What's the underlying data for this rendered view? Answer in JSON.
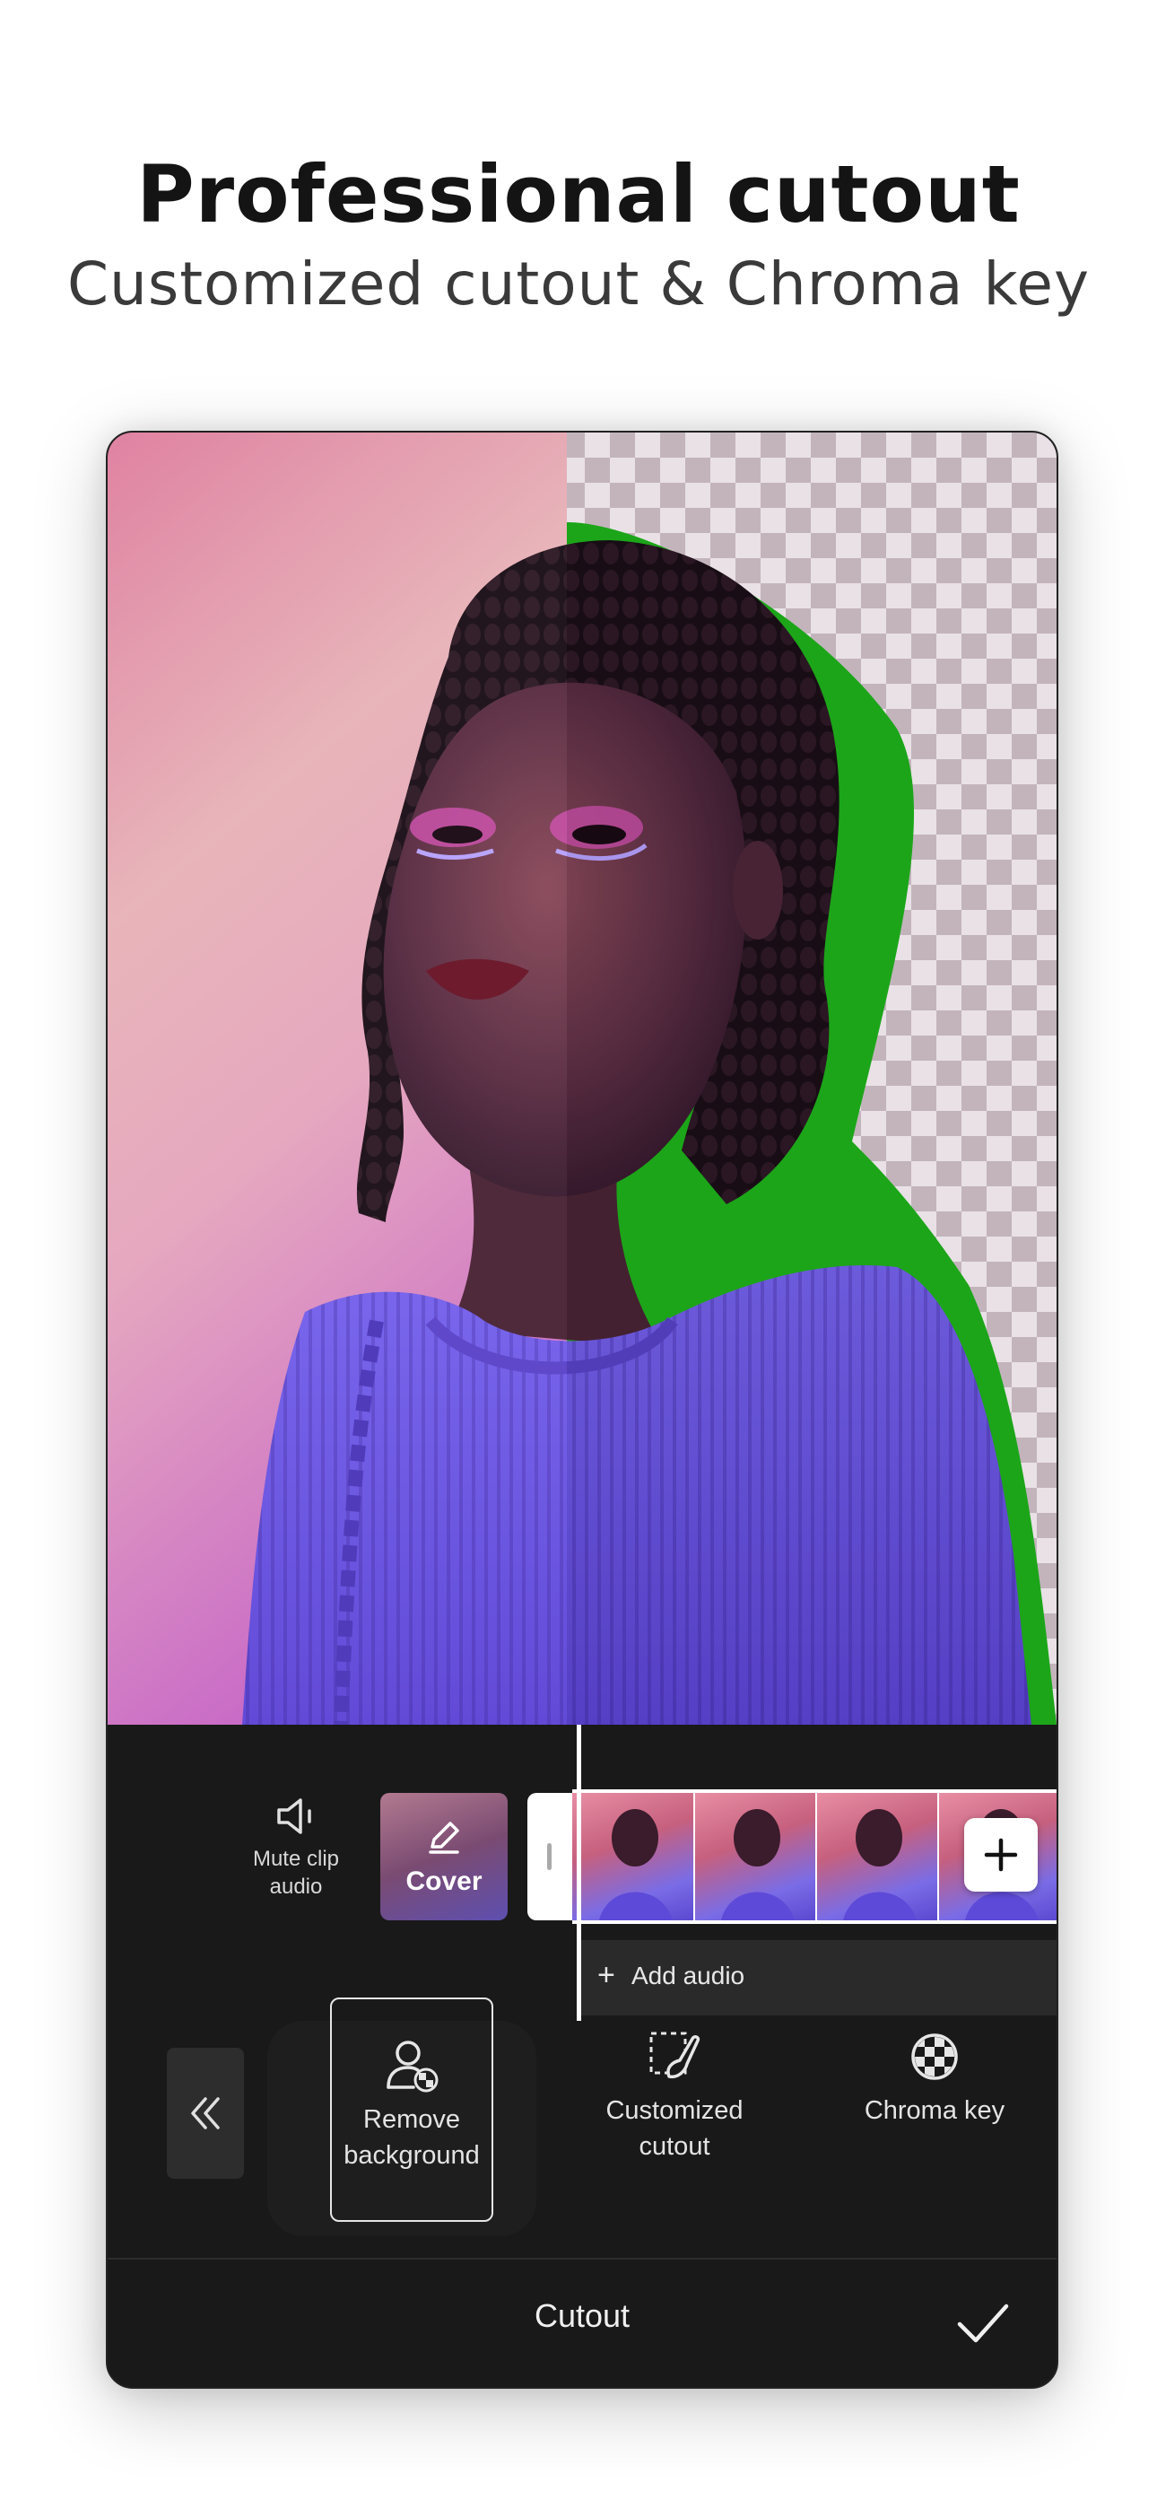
{
  "header": {
    "title": "Professional cutout",
    "subtitle": "Customized cutout & Chroma key"
  },
  "timeline": {
    "mute_label": "Mute clip audio",
    "mute_label_line1": "Mute clip",
    "mute_label_line2": "audio",
    "cover_label": "Cover",
    "add_audio_label": "Add audio"
  },
  "tools": {
    "remove_background_line1": "Remove",
    "remove_background_line2": "background",
    "customized_cutout_line1": "Customized",
    "customized_cutout_line2": "cutout",
    "chroma_key": "Chroma key"
  },
  "bottom_bar": {
    "title": "Cutout"
  },
  "colors": {
    "accent_green": "#1fb41c",
    "background_pink": "#e07da0",
    "sweater_purple": "#6d55e6",
    "panel_dark": "#191919"
  }
}
